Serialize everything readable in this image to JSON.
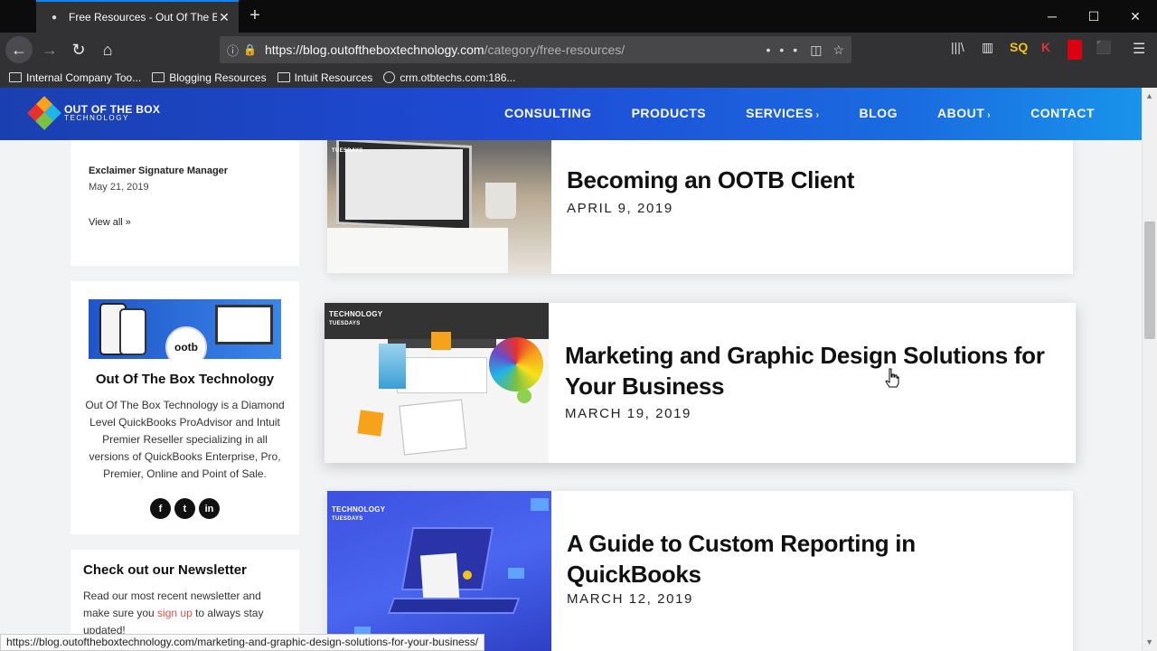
{
  "browser": {
    "tab_title": "Free Resources - Out Of The Bo",
    "url_domain": "https://blog.outoftheboxtechnology.com",
    "url_path": "/category/free-resources/",
    "bookmarks": [
      {
        "label": "Internal Company Too...",
        "icon": "folder-icon"
      },
      {
        "label": "Blogging Resources",
        "icon": "folder-icon"
      },
      {
        "label": "Intuit Resources",
        "icon": "folder-icon"
      },
      {
        "label": "crm.otbtechs.com:186...",
        "icon": "globe-icon"
      }
    ],
    "status_url": "https://blog.outoftheboxtechnology.com/marketing-and-graphic-design-solutions-for-your-business/"
  },
  "site": {
    "logo_line1": "OUT OF THE BOX",
    "logo_line2": "TECHNOLOGY",
    "nav": [
      {
        "label": "CONSULTING"
      },
      {
        "label": "PRODUCTS"
      },
      {
        "label": "SERVICES",
        "caret": "›"
      },
      {
        "label": "BLOG"
      },
      {
        "label": "ABOUT",
        "caret": "›"
      },
      {
        "label": "CONTACT"
      }
    ]
  },
  "sidebar": {
    "recent_post_title": "Exclaimer Signature Manager",
    "recent_post_date": "May 21, 2019",
    "view_all": "View all »",
    "badge_text": "ootb",
    "company_name": "Out Of The Box Technology",
    "company_desc": "Out Of The Box Technology is a Diamond Level QuickBooks ProAdvisor and Intuit Premier Reseller specializing in all versions of QuickBooks Enterprise, Pro, Premier, Online and Point of Sale.",
    "social": [
      "f",
      "t",
      "in"
    ],
    "newsletter_title": "Check out our Newsletter",
    "newsletter_pre": "Read our most recent newsletter and make sure you ",
    "newsletter_link": "sign up",
    "newsletter_post": " to always stay updated!"
  },
  "posts": [
    {
      "title": "Becoming an OOTB Client",
      "date": "APRIL 9, 2019",
      "tag1": "",
      "tag2": "TUESDAYS"
    },
    {
      "title": "Marketing and Graphic Design Solutions for Your Business",
      "date": "MARCH 19, 2019",
      "tag1": "TECHNOLOGY",
      "tag2": "TUESDAYS"
    },
    {
      "title": "A Guide to Custom Reporting in QuickBooks",
      "date": "MARCH 12, 2019",
      "tag1": "TECHNOLOGY",
      "tag2": "TUESDAYS"
    }
  ],
  "colors": {
    "header_start": "#1a3fb0",
    "header_end": "#1894ea",
    "accent_link": "#d9534f"
  }
}
